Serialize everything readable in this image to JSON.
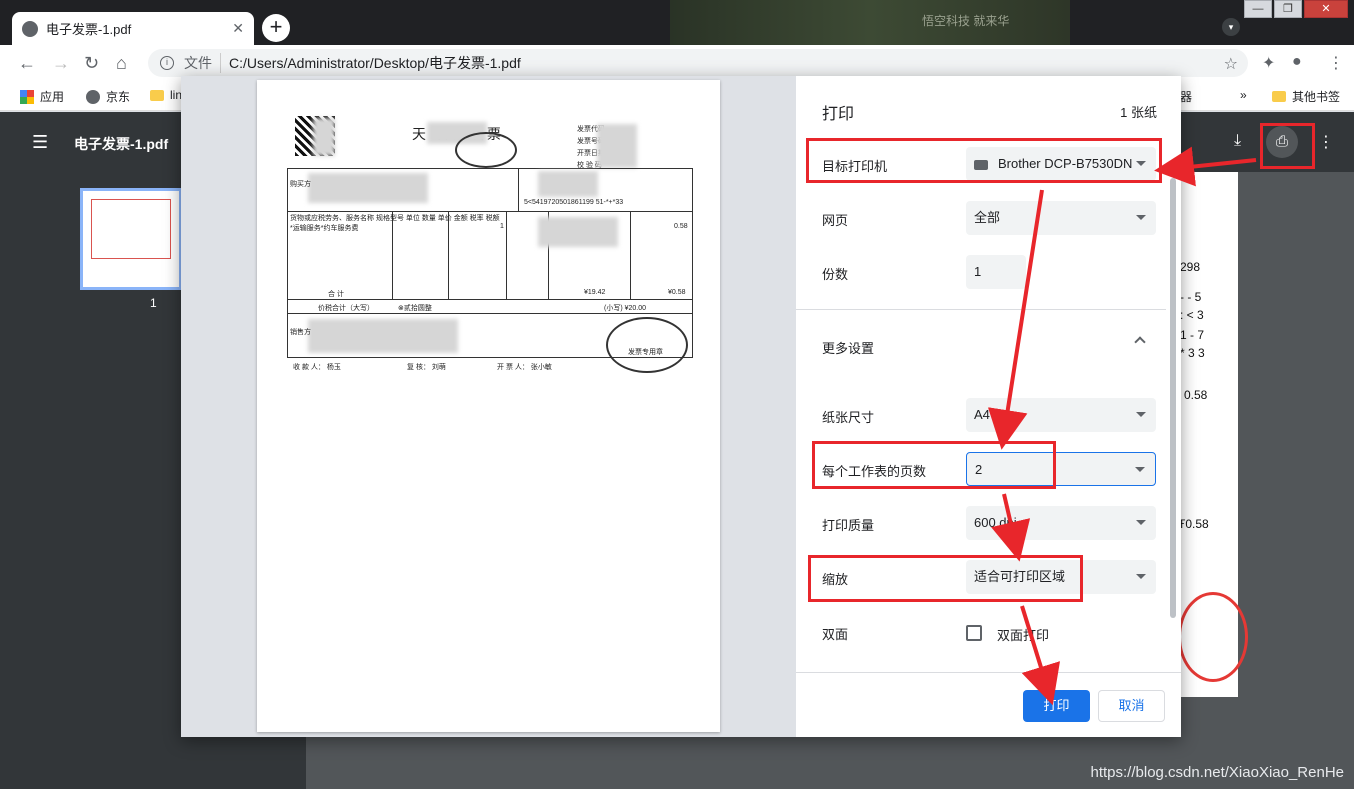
{
  "browser": {
    "tab_title": "电子发票-1.pdf",
    "tab_close": "✕",
    "new_tab": "+",
    "blurred_tab_text": "悟空科技 就来华",
    "window_controls": [
      "—",
      "❐",
      "✕"
    ],
    "address_scheme": "文件",
    "address_url": "C:/Users/Administrator/Desktop/电子发票-1.pdf"
  },
  "bookmarks": {
    "items": [
      "应用",
      "京东",
      "lin"
    ],
    "right_partial": "器",
    "overflow": "»",
    "other": "其他书签"
  },
  "pdf_viewer": {
    "file_name": "电子发票-1.pdf",
    "thumbnail_page": "1",
    "bg_numbers": [
      "298",
      "- - 5",
      ": < 3",
      "1 - 7",
      "* 3 3",
      "0.58",
      "Ŧ0.58"
    ]
  },
  "invoice": {
    "title": "天  普通发票",
    "code_lines": [
      "发票代码",
      "发票号码",
      "开票日期",
      "校 验 码"
    ],
    "item": "*运输服务*约车服务费",
    "qty": "1",
    "tax": "0.58",
    "amount_total": "¥19.42",
    "tax_total": "¥0.58",
    "total_lower": "(小写) ¥20.00",
    "total_upper": "⊗贰拾圆整",
    "header_row": "货物或应税劳务、服务名称   规格型号   单位   数量   单价   金额   税率   税额",
    "sum_label": "合    计",
    "tax_sum_label": "价税合计（大写）",
    "payee": "收 款 人： 杨玉",
    "reviewer": "复  核： 刘萌",
    "drawer": "开 票 人： 张小敏",
    "seller_label": "销售方",
    "buyer_label": "购买方",
    "code_row": "5<5419720501861199 51-*+*33",
    "stamp_text": "发票专用章"
  },
  "print_dialog": {
    "title": "打印",
    "sheet_count": "1 张纸",
    "rows": {
      "destination": {
        "label": "目标打印机",
        "value": "Brother DCP-B7530DN"
      },
      "pages": {
        "label": "网页",
        "value": "全部"
      },
      "copies": {
        "label": "份数",
        "value": "1"
      },
      "more_settings": {
        "label": "更多设置"
      },
      "paper_size": {
        "label": "纸张尺寸",
        "value": "A4"
      },
      "pages_per_sheet": {
        "label": "每个工作表的页数",
        "value": "2"
      },
      "quality": {
        "label": "打印质量",
        "value": "600 dpi"
      },
      "scale": {
        "label": "缩放",
        "value": "适合可打印区域"
      },
      "duplex": {
        "label": "双面",
        "checkbox_label": "双面打印"
      }
    },
    "print_button": "打印",
    "cancel_button": "取消"
  },
  "watermark": "https://blog.csdn.net/XiaoXiao_RenHe",
  "colors": {
    "annotation_red": "#e8262b",
    "primary_blue": "#1a73e8",
    "pdf_toolbar": "#323639"
  }
}
